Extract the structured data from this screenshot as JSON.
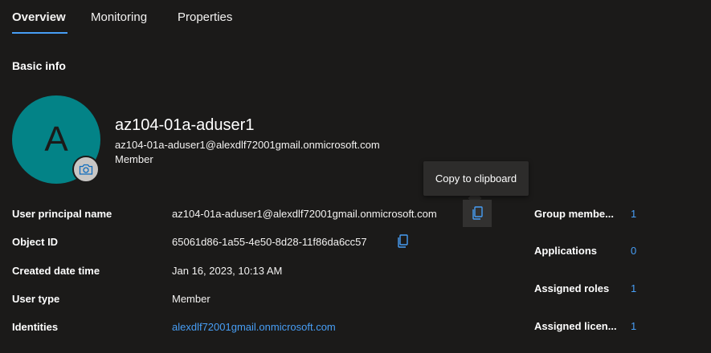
{
  "tabs": [
    {
      "label": "Overview",
      "active": true
    },
    {
      "label": "Monitoring",
      "active": false
    },
    {
      "label": "Properties",
      "active": false
    }
  ],
  "section_title": "Basic info",
  "user": {
    "initial": "A",
    "display_name": "az104-01a-aduser1",
    "email": "az104-01a-aduser1@alexdlf72001gmail.onmicrosoft.com",
    "type": "Member"
  },
  "tooltip": "Copy to clipboard",
  "properties": [
    {
      "label": "User principal name",
      "value": "az104-01a-aduser1@alexdlf72001gmail.onmicrosoft.com"
    },
    {
      "label": "Object ID",
      "value": "65061d86-1a55-4e50-8d28-11f86da6cc57"
    },
    {
      "label": "Created date time",
      "value": "Jan 16, 2023, 10:13 AM"
    },
    {
      "label": "User type",
      "value": "Member"
    },
    {
      "label": "Identities",
      "value": "alexdlf72001gmail.onmicrosoft.com"
    }
  ],
  "summary": [
    {
      "label": "Group membe...",
      "value": "1"
    },
    {
      "label": "Applications",
      "value": "0"
    },
    {
      "label": "Assigned roles",
      "value": "1"
    },
    {
      "label": "Assigned licen...",
      "value": "1"
    }
  ],
  "icons": {
    "camera": "camera-icon",
    "copy": "copy-icon"
  },
  "colors": {
    "background": "#1b1a19",
    "accent": "#479ef5",
    "avatar": "#038387"
  }
}
